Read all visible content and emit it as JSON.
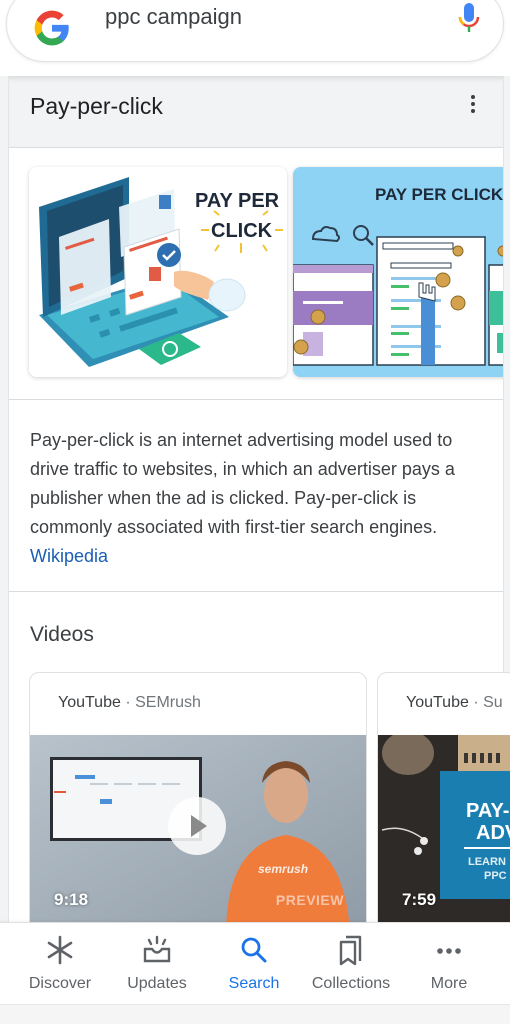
{
  "search": {
    "query": "ppc campaign",
    "logo": "google-g-icon",
    "voice_icon": "mic-icon"
  },
  "knowledge_panel": {
    "title": "Pay-per-click",
    "menu_icon": "more-vert-icon",
    "images": [
      {
        "caption": "PAY PER CLICK",
        "line1": "PAY PER",
        "line2": "CLICK",
        "style": "laptop-illustration"
      },
      {
        "caption": "PAY PER CLICK",
        "style": "browser-windows-illustration"
      }
    ],
    "description": "Pay-per-click is an internet advertising model used to drive traffic to websites, in which an advertiser pays a publisher when the ad is clicked. Pay-per-click is commonly associated with first-tier search engines.",
    "source_link": "Wikipedia"
  },
  "videos": {
    "title": "Videos",
    "items": [
      {
        "platform": "YouTube",
        "channel": "SEMrush",
        "duration": "9:18",
        "overlay": "PREVIEW",
        "shirt_text": "semrush"
      },
      {
        "platform": "YouTube",
        "channel": "Su",
        "duration": "7:59",
        "thumb_line1": "PAY-",
        "thumb_line2": "ADV",
        "thumb_line3": "LEARN",
        "thumb_line4": "PPC"
      }
    ],
    "separator": " · "
  },
  "bottom_nav": {
    "items": [
      {
        "label": "Discover",
        "icon": "asterisk-icon",
        "active": false
      },
      {
        "label": "Updates",
        "icon": "updates-inbox-icon",
        "active": false
      },
      {
        "label": "Search",
        "icon": "search-icon",
        "active": true
      },
      {
        "label": "Collections",
        "icon": "collections-bookmark-icon",
        "active": false
      },
      {
        "label": "More",
        "icon": "more-horiz-icon",
        "active": false
      }
    ]
  },
  "colors": {
    "accent": "#1a73e8",
    "link": "#1a5fb4",
    "text": "#3c4043"
  }
}
